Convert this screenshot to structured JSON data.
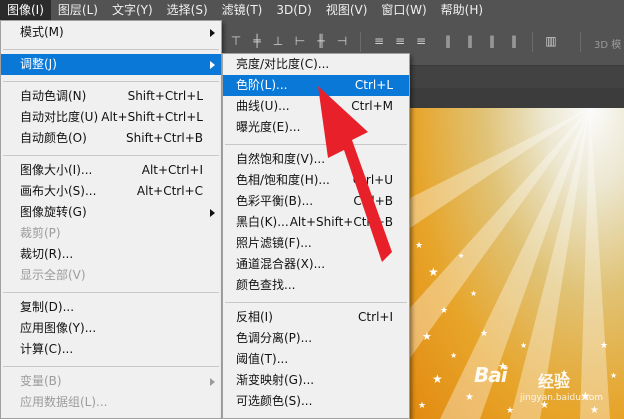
{
  "menubar": {
    "items": [
      {
        "label": "图像(I)"
      },
      {
        "label": "图层(L)"
      },
      {
        "label": "文字(Y)"
      },
      {
        "label": "选择(S)"
      },
      {
        "label": "滤镜(T)"
      },
      {
        "label": "3D(D)"
      },
      {
        "label": "视图(V)"
      },
      {
        "label": "窗口(W)"
      },
      {
        "label": "帮助(H)"
      }
    ]
  },
  "toolbar": {
    "mode_3d_label": "3D 模"
  },
  "image_menu": {
    "mode": {
      "label": "模式(M)"
    },
    "adjust": {
      "label": "调整(J)"
    },
    "auto_tone": {
      "label": "自动色调(N)",
      "shortcut": "Shift+Ctrl+L"
    },
    "auto_contrast": {
      "label": "自动对比度(U)",
      "shortcut": "Alt+Shift+Ctrl+L"
    },
    "auto_color": {
      "label": "自动颜色(O)",
      "shortcut": "Shift+Ctrl+B"
    },
    "image_size": {
      "label": "图像大小(I)...",
      "shortcut": "Alt+Ctrl+I"
    },
    "canvas_size": {
      "label": "画布大小(S)...",
      "shortcut": "Alt+Ctrl+C"
    },
    "rotation": {
      "label": "图像旋转(G)"
    },
    "crop": {
      "label": "裁剪(P)"
    },
    "trim": {
      "label": "裁切(R)..."
    },
    "reveal_all": {
      "label": "显示全部(V)"
    },
    "duplicate": {
      "label": "复制(D)..."
    },
    "apply_image": {
      "label": "应用图像(Y)..."
    },
    "calculations": {
      "label": "计算(C)..."
    },
    "variables": {
      "label": "变量(B)"
    },
    "apply_data_set": {
      "label": "应用数据组(L)..."
    }
  },
  "adjust_menu": {
    "brightness_contrast": {
      "label": "亮度/对比度(C)..."
    },
    "levels": {
      "label": "色阶(L)...",
      "shortcut": "Ctrl+L"
    },
    "curves": {
      "label": "曲线(U)...",
      "shortcut": "Ctrl+M"
    },
    "exposure": {
      "label": "曝光度(E)..."
    },
    "vibrance": {
      "label": "自然饱和度(V)..."
    },
    "hue_saturation": {
      "label": "色相/饱和度(H)...",
      "shortcut": "Ctrl+U"
    },
    "color_balance": {
      "label": "色彩平衡(B)...",
      "shortcut": "Ctrl+B"
    },
    "black_white": {
      "label": "黑白(K)...",
      "shortcut": "Alt+Shift+Ctrl+B"
    },
    "photo_filter": {
      "label": "照片滤镜(F)..."
    },
    "channel_mixer": {
      "label": "通道混合器(X)..."
    },
    "color_lookup": {
      "label": "颜色查找..."
    },
    "invert": {
      "label": "反相(I)",
      "shortcut": "Ctrl+I"
    },
    "posterize": {
      "label": "色调分离(P)..."
    },
    "threshold": {
      "label": "阈值(T)..."
    },
    "gradient_map": {
      "label": "渐变映射(G)..."
    },
    "selective_color": {
      "label": "可选颜色(S)..."
    }
  },
  "watermark": {
    "brand": "Bai",
    "brand_suffix": "经验",
    "url": "jingyan.baidu.com"
  },
  "colors": {
    "highlight": "#0a78d7",
    "annotation_arrow": "#e8202a"
  }
}
